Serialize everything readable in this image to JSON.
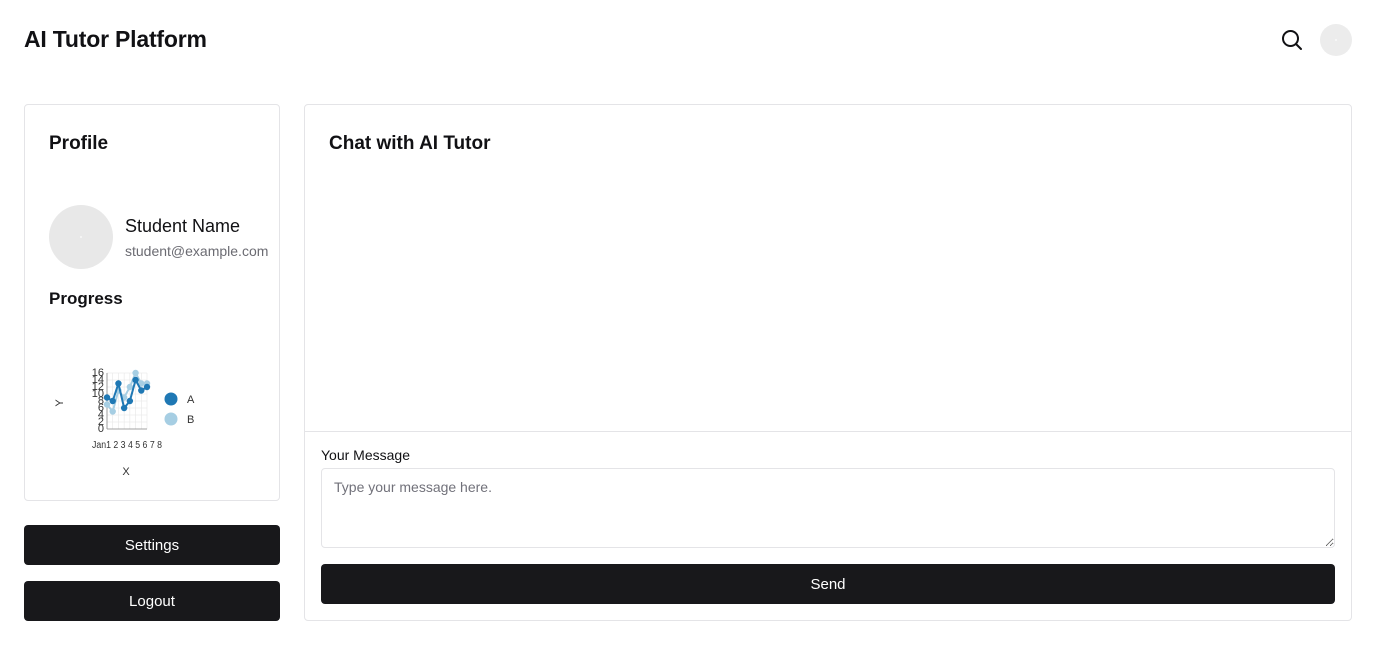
{
  "header": {
    "app_title": "AI Tutor Platform",
    "search_icon": "search-icon",
    "avatar_icon": "user-avatar"
  },
  "profile": {
    "heading": "Profile",
    "name": "Student Name",
    "email": "student@example.com",
    "progress_heading": "Progress"
  },
  "chart_data": {
    "type": "line",
    "xlabel": "X",
    "ylabel": "Y",
    "ylim": [
      0,
      16
    ],
    "y_ticks": [
      "0",
      "2",
      "4",
      "6",
      "8",
      "10",
      "12",
      "14",
      "16"
    ],
    "x": [
      1,
      2,
      3,
      4,
      5,
      6,
      7,
      8
    ],
    "x_tick_text": "Jan 1 ... 8",
    "series": [
      {
        "name": "A",
        "color": "#1f78b4",
        "values": [
          9,
          8,
          13,
          6,
          8,
          14,
          11,
          12
        ]
      },
      {
        "name": "B",
        "color": "#a6cee3",
        "values": [
          7,
          5,
          11,
          9,
          12,
          16,
          13,
          13
        ]
      }
    ],
    "legend": "right",
    "grid": true
  },
  "actions": {
    "settings_label": "Settings",
    "logout_label": "Logout"
  },
  "chat": {
    "heading": "Chat with AI Tutor",
    "message_label": "Your Message",
    "message_placeholder": "Type your message here.",
    "message_value": "",
    "send_label": "Send"
  },
  "colors": {
    "primary_button": "#18181b",
    "border": "#e4e4e7",
    "muted_text": "#6b6b72"
  }
}
